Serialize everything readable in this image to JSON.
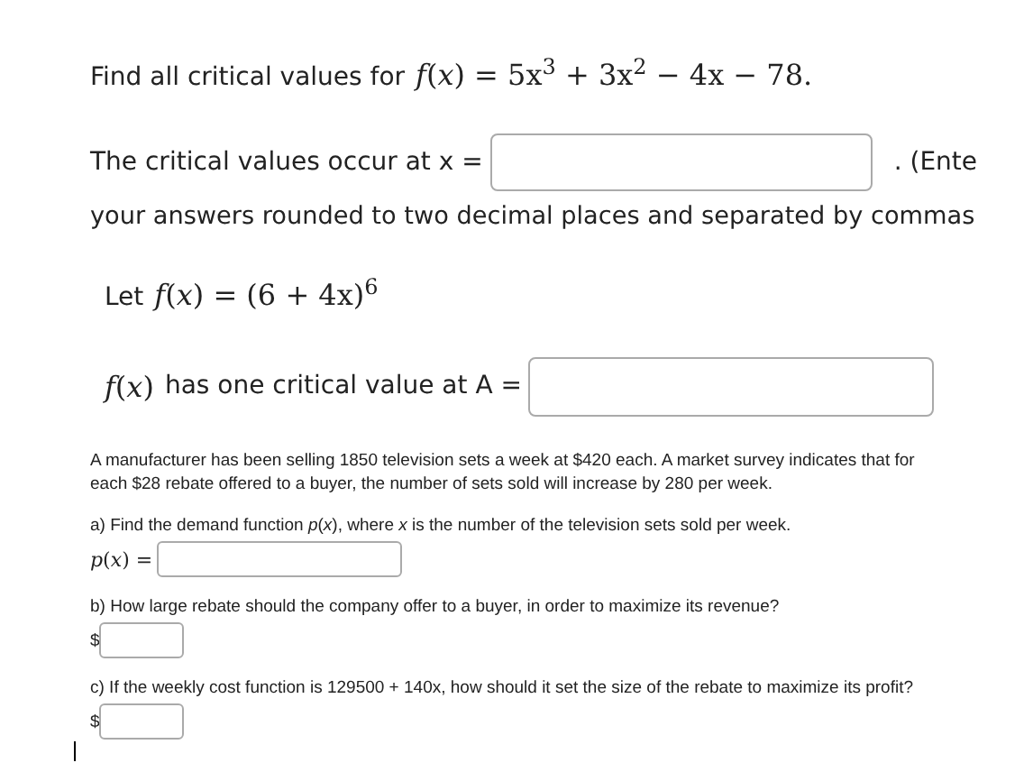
{
  "question_1": {
    "prompt": "Find all critical values for",
    "formula": "*f*(*x*) = 5x$^{3}$ + 3x$^{2}$ − 4x − 78.",
    "answer_label": "The critical values occur at x =",
    "after_field": ". (Ente",
    "instruction": "your answers rounded to two decimal places and separated by commas"
  },
  "question_2": {
    "prompt": "Let",
    "formula": "*f*(*x*) = (6 + 4x)$^{6}$",
    "answer_formula": "*f*(*x*)",
    "answer_label": "has one critical value at A ="
  },
  "question_3": {
    "intro": "A manufacturer has been selling 1850 television sets a week at $420 each. A market survey indicates that for each $28 rebate offered to a buyer, the number of sets sold will increase by 280 per week.",
    "parts": [
      {
        "kind": "formula",
        "question": "a) Find the demand function *p*(*x*), where *x* is the number of the television sets sold per week.",
        "answer_prefix": "*p*(*x*) ="
      },
      {
        "kind": "money",
        "question": "b) How large rebate should the company offer to a buyer, in order to maximize its revenue?",
        "answer_prefix": "$"
      },
      {
        "kind": "money",
        "question": "c) If the weekly cost function is 129500 + 140x, how should it set the size of the rebate to maximize its profit?",
        "answer_prefix": "$"
      }
    ]
  }
}
